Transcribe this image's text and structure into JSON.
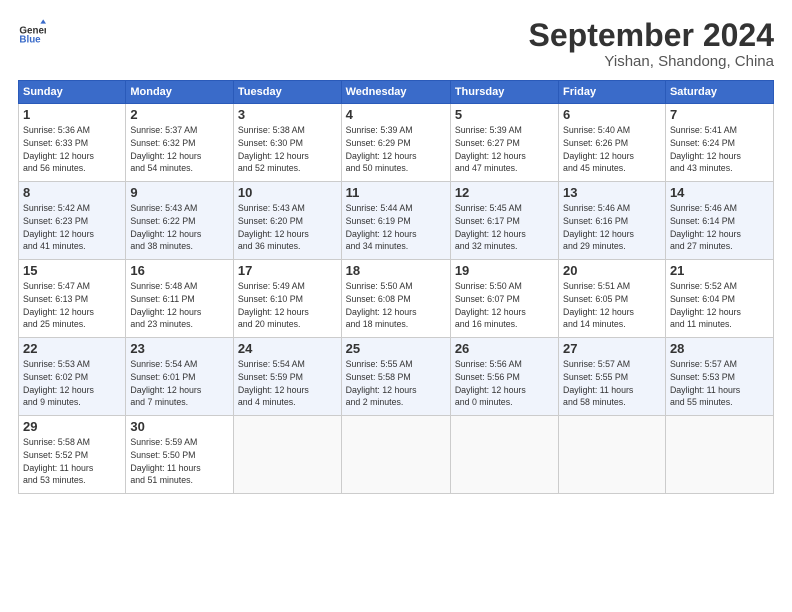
{
  "header": {
    "logo_line1": "General",
    "logo_line2": "Blue",
    "month_title": "September 2024",
    "location": "Yishan, Shandong, China"
  },
  "days_of_week": [
    "Sunday",
    "Monday",
    "Tuesday",
    "Wednesday",
    "Thursday",
    "Friday",
    "Saturday"
  ],
  "weeks": [
    [
      {
        "day": 1,
        "info": "Sunrise: 5:36 AM\nSunset: 6:33 PM\nDaylight: 12 hours\nand 56 minutes."
      },
      {
        "day": 2,
        "info": "Sunrise: 5:37 AM\nSunset: 6:32 PM\nDaylight: 12 hours\nand 54 minutes."
      },
      {
        "day": 3,
        "info": "Sunrise: 5:38 AM\nSunset: 6:30 PM\nDaylight: 12 hours\nand 52 minutes."
      },
      {
        "day": 4,
        "info": "Sunrise: 5:39 AM\nSunset: 6:29 PM\nDaylight: 12 hours\nand 50 minutes."
      },
      {
        "day": 5,
        "info": "Sunrise: 5:39 AM\nSunset: 6:27 PM\nDaylight: 12 hours\nand 47 minutes."
      },
      {
        "day": 6,
        "info": "Sunrise: 5:40 AM\nSunset: 6:26 PM\nDaylight: 12 hours\nand 45 minutes."
      },
      {
        "day": 7,
        "info": "Sunrise: 5:41 AM\nSunset: 6:24 PM\nDaylight: 12 hours\nand 43 minutes."
      }
    ],
    [
      {
        "day": 8,
        "info": "Sunrise: 5:42 AM\nSunset: 6:23 PM\nDaylight: 12 hours\nand 41 minutes."
      },
      {
        "day": 9,
        "info": "Sunrise: 5:43 AM\nSunset: 6:22 PM\nDaylight: 12 hours\nand 38 minutes."
      },
      {
        "day": 10,
        "info": "Sunrise: 5:43 AM\nSunset: 6:20 PM\nDaylight: 12 hours\nand 36 minutes."
      },
      {
        "day": 11,
        "info": "Sunrise: 5:44 AM\nSunset: 6:19 PM\nDaylight: 12 hours\nand 34 minutes."
      },
      {
        "day": 12,
        "info": "Sunrise: 5:45 AM\nSunset: 6:17 PM\nDaylight: 12 hours\nand 32 minutes."
      },
      {
        "day": 13,
        "info": "Sunrise: 5:46 AM\nSunset: 6:16 PM\nDaylight: 12 hours\nand 29 minutes."
      },
      {
        "day": 14,
        "info": "Sunrise: 5:46 AM\nSunset: 6:14 PM\nDaylight: 12 hours\nand 27 minutes."
      }
    ],
    [
      {
        "day": 15,
        "info": "Sunrise: 5:47 AM\nSunset: 6:13 PM\nDaylight: 12 hours\nand 25 minutes."
      },
      {
        "day": 16,
        "info": "Sunrise: 5:48 AM\nSunset: 6:11 PM\nDaylight: 12 hours\nand 23 minutes."
      },
      {
        "day": 17,
        "info": "Sunrise: 5:49 AM\nSunset: 6:10 PM\nDaylight: 12 hours\nand 20 minutes."
      },
      {
        "day": 18,
        "info": "Sunrise: 5:50 AM\nSunset: 6:08 PM\nDaylight: 12 hours\nand 18 minutes."
      },
      {
        "day": 19,
        "info": "Sunrise: 5:50 AM\nSunset: 6:07 PM\nDaylight: 12 hours\nand 16 minutes."
      },
      {
        "day": 20,
        "info": "Sunrise: 5:51 AM\nSunset: 6:05 PM\nDaylight: 12 hours\nand 14 minutes."
      },
      {
        "day": 21,
        "info": "Sunrise: 5:52 AM\nSunset: 6:04 PM\nDaylight: 12 hours\nand 11 minutes."
      }
    ],
    [
      {
        "day": 22,
        "info": "Sunrise: 5:53 AM\nSunset: 6:02 PM\nDaylight: 12 hours\nand 9 minutes."
      },
      {
        "day": 23,
        "info": "Sunrise: 5:54 AM\nSunset: 6:01 PM\nDaylight: 12 hours\nand 7 minutes."
      },
      {
        "day": 24,
        "info": "Sunrise: 5:54 AM\nSunset: 5:59 PM\nDaylight: 12 hours\nand 4 minutes."
      },
      {
        "day": 25,
        "info": "Sunrise: 5:55 AM\nSunset: 5:58 PM\nDaylight: 12 hours\nand 2 minutes."
      },
      {
        "day": 26,
        "info": "Sunrise: 5:56 AM\nSunset: 5:56 PM\nDaylight: 12 hours\nand 0 minutes."
      },
      {
        "day": 27,
        "info": "Sunrise: 5:57 AM\nSunset: 5:55 PM\nDaylight: 11 hours\nand 58 minutes."
      },
      {
        "day": 28,
        "info": "Sunrise: 5:57 AM\nSunset: 5:53 PM\nDaylight: 11 hours\nand 55 minutes."
      }
    ],
    [
      {
        "day": 29,
        "info": "Sunrise: 5:58 AM\nSunset: 5:52 PM\nDaylight: 11 hours\nand 53 minutes."
      },
      {
        "day": 30,
        "info": "Sunrise: 5:59 AM\nSunset: 5:50 PM\nDaylight: 11 hours\nand 51 minutes."
      },
      null,
      null,
      null,
      null,
      null
    ]
  ]
}
